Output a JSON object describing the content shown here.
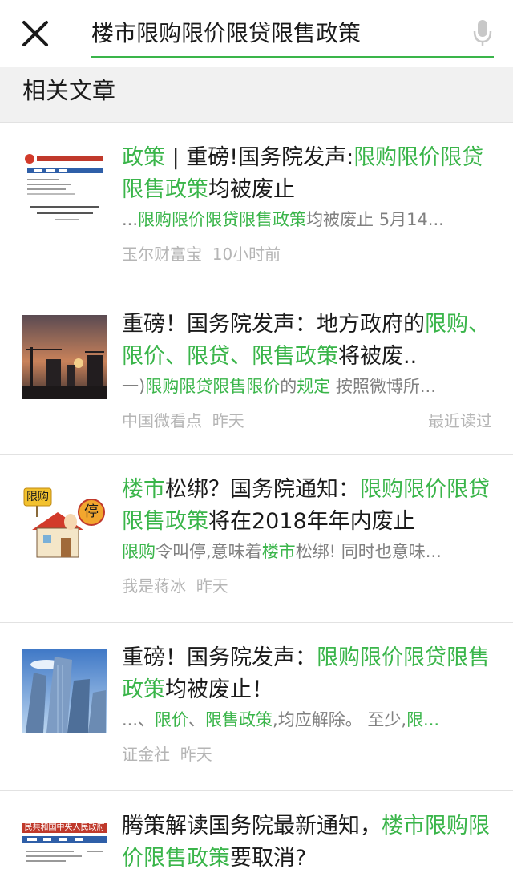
{
  "search": {
    "query": "楼市限购限价限贷限售政策"
  },
  "section_title": "相关文章",
  "colors": {
    "accent": "#3ab54a",
    "meta": "#b5b5b5",
    "snippet": "#808080"
  },
  "articles": [
    {
      "title": [
        {
          "t": "政策",
          "hl": true
        },
        {
          "t": " | 重磅!国务院发声:",
          "hl": false
        },
        {
          "t": "限购限价限贷限售政策",
          "hl": true
        },
        {
          "t": "均被废止",
          "hl": false
        }
      ],
      "snippet": [
        {
          "t": "...",
          "hl": false
        },
        {
          "t": "限购限价限贷限售政策",
          "hl": true
        },
        {
          "t": "均被废止 5月14...",
          "hl": false
        }
      ],
      "source": "玉尔财富宝",
      "time": "10小时前",
      "read_status": "",
      "thumb": "gov-document"
    },
    {
      "title": [
        {
          "t": "重磅！国务院发声：地方政府的",
          "hl": false
        },
        {
          "t": "限购、限价、限贷、限售政策",
          "hl": true
        },
        {
          "t": "将被废..",
          "hl": false
        }
      ],
      "snippet": [
        {
          "t": "一)",
          "hl": false
        },
        {
          "t": "限购限贷限售限价",
          "hl": true
        },
        {
          "t": "的",
          "hl": false
        },
        {
          "t": "规定",
          "hl": true
        },
        {
          "t": " 按照微博所...",
          "hl": false
        }
      ],
      "source": "中国微看点",
      "time": "昨天",
      "read_status": "最近读过",
      "thumb": "sunset-construction"
    },
    {
      "title": [
        {
          "t": "楼市",
          "hl": true
        },
        {
          "t": "松绑？国务院通知：",
          "hl": false
        },
        {
          "t": "限购限价限贷限售政策",
          "hl": true
        },
        {
          "t": "将在2018年年内废止",
          "hl": false
        }
      ],
      "snippet": [
        {
          "t": "限购",
          "hl": true
        },
        {
          "t": "令叫停,意味着",
          "hl": false
        },
        {
          "t": "楼市",
          "hl": true
        },
        {
          "t": "松绑! 同时也意味...",
          "hl": false
        }
      ],
      "source": "我是蒋冰",
      "time": "昨天",
      "read_status": "",
      "thumb": "cartoon-house",
      "thumb_texts": {
        "sign": "限购",
        "stop": "停"
      }
    },
    {
      "title": [
        {
          "t": "重磅！国务院发声：",
          "hl": false
        },
        {
          "t": "限购限价限贷限售政策",
          "hl": true
        },
        {
          "t": "均被废止！",
          "hl": false
        }
      ],
      "snippet": [
        {
          "t": "...、",
          "hl": false
        },
        {
          "t": "限价",
          "hl": true
        },
        {
          "t": "、",
          "hl": false
        },
        {
          "t": "限售政策",
          "hl": true
        },
        {
          "t": ",均应解除。 至少,",
          "hl": false
        },
        {
          "t": "限...",
          "hl": true
        }
      ],
      "source": "证金社",
      "time": "昨天",
      "read_status": "",
      "thumb": "skyscrapers"
    },
    {
      "title": [
        {
          "t": "腾策解读国务院最新通知，",
          "hl": false
        },
        {
          "t": "楼市限购限价限售政策",
          "hl": true
        },
        {
          "t": "要取消?",
          "hl": false
        }
      ],
      "snippet": [],
      "source": "",
      "time": "",
      "read_status": "",
      "thumb": "gov-document-2",
      "thumb_texts": {
        "banner": "民共和国中央人民政府"
      }
    }
  ]
}
